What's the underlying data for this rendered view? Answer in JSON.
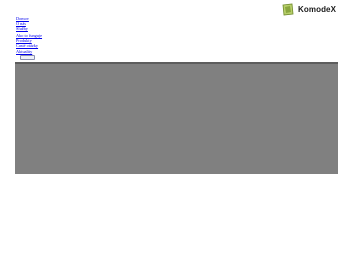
{
  "brand": {
    "name": "KomodeX",
    "accent": "#9bb84a",
    "icon": "leaf-cube-icon"
  },
  "top_links": [
    {
      "label": "Domov"
    },
    {
      "label": "O nás"
    },
    {
      "label": "Služby"
    }
  ],
  "secondary_links": [
    {
      "label": "Ako to funguje"
    },
    {
      "label": "Produkty"
    },
    {
      "label": "Časté otázky"
    },
    {
      "label": "Aktuality"
    }
  ],
  "mini_button": {
    "label": ""
  },
  "colors": {
    "link": "#0000ee",
    "viewport": "#808080",
    "viewport_border": "#5d5d5d"
  }
}
